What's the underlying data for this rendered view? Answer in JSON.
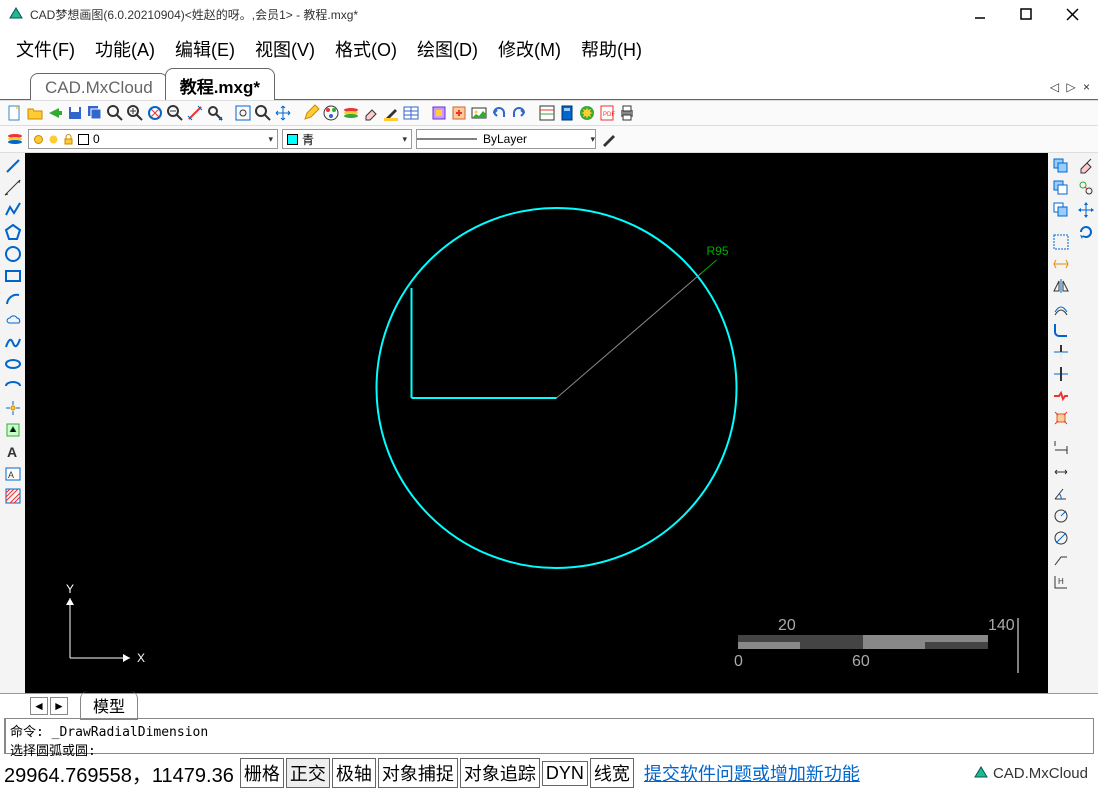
{
  "window": {
    "title": "CAD梦想画图(6.0.20210904)<姓赵的呀。,会员1> - 教程.mxg*"
  },
  "menu": {
    "file": "文件(F)",
    "function": "功能(A)",
    "edit": "编辑(E)",
    "view": "视图(V)",
    "format": "格式(O)",
    "draw": "绘图(D)",
    "modify": "修改(M)",
    "help": "帮助(H)"
  },
  "tabs": {
    "t1": "CAD.MxCloud",
    "t2": "教程.mxg*"
  },
  "layer": {
    "name": "0"
  },
  "color": {
    "name": "青",
    "hex": "#00FFFF"
  },
  "linetype": {
    "name": "ByLayer"
  },
  "drawing": {
    "radius_label": "R95",
    "scale": {
      "a": "20",
      "b": "140",
      "c": "0",
      "d": "60"
    },
    "axis_x": "X",
    "axis_y": "Y"
  },
  "viewtab": "模型",
  "command": {
    "line1": "命令: _DrawRadialDimension",
    "line2": "选择圆弧或圆:"
  },
  "status": {
    "coords": "29964.769558，11479.36",
    "grid": "栅格",
    "ortho": "正交",
    "polar": "极轴",
    "osnap": "对象捕捉",
    "otrack": "对象追踪",
    "dyn": "DYN",
    "lweight": "线宽",
    "feedback": "提交软件问题或增加新功能",
    "brand": "CAD.MxCloud"
  }
}
